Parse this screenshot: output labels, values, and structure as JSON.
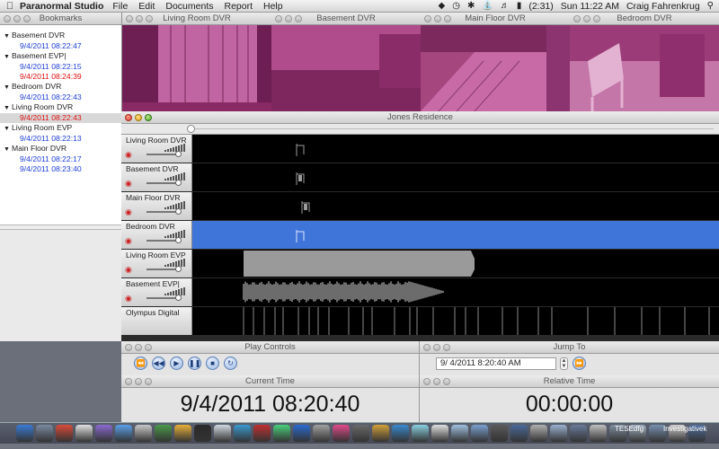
{
  "menubar": {
    "app_name": "Paranormal Studio",
    "menus": [
      "File",
      "Edit",
      "Documents",
      "Report",
      "Help"
    ],
    "battery": "(2:31)",
    "clock": "Sun 11:22 AM",
    "user": "Craig Fahrenkrug"
  },
  "bookmarks": {
    "title": "Bookmarks",
    "groups": [
      {
        "name": "Basement DVR",
        "entries": [
          {
            "time": "9/4/2011 08:22:47",
            "color": "blue"
          }
        ]
      },
      {
        "name": "Basement EVP|",
        "entries": [
          {
            "time": "9/4/2011 08:22:15",
            "color": "blue"
          },
          {
            "time": "9/4/2011 08:24:39",
            "color": "red"
          }
        ]
      },
      {
        "name": "Bedroom DVR",
        "entries": [
          {
            "time": "9/4/2011 08:22:43",
            "color": "blue"
          }
        ]
      },
      {
        "name": "Living Room DVR",
        "entries": [
          {
            "time": "9/4/2011 08:22:43",
            "color": "red",
            "selected": true
          }
        ]
      },
      {
        "name": "Living Room EVP",
        "entries": [
          {
            "time": "9/4/2011 08:22:13",
            "color": "blue"
          }
        ]
      },
      {
        "name": "Main Floor DVR",
        "entries": [
          {
            "time": "9/4/2011 08:22:17",
            "color": "blue"
          },
          {
            "time": "9/4/2011 08:23:40",
            "color": "blue"
          }
        ]
      }
    ]
  },
  "cameras": [
    {
      "title": "Living Room DVR"
    },
    {
      "title": "Basement DVR"
    },
    {
      "title": "Main Floor DVR"
    },
    {
      "title": "Bedroom DVR"
    }
  ],
  "timeline": {
    "title": "Jones Residence",
    "tracks": [
      {
        "name": "Living Room DVR"
      },
      {
        "name": "Basement DVR"
      },
      {
        "name": "Main Floor DVR"
      },
      {
        "name": "Bedroom DVR",
        "selected": true
      },
      {
        "name": "Living Room EVP"
      },
      {
        "name": "Basement EVP|"
      },
      {
        "name": "Olympus Digital"
      }
    ]
  },
  "play_controls": {
    "title": "Play Controls"
  },
  "jump_to": {
    "title": "Jump To",
    "value": "9/  4/2011    8:20:40 AM"
  },
  "current_time": {
    "title": "Current Time",
    "value": "9/4/2011 08:20:40"
  },
  "relative_time": {
    "title": "Relative Time",
    "value": "00:00:00"
  },
  "dock": {
    "labels": [
      "TESEdfg",
      "Investigativek"
    ]
  },
  "colors": {
    "selected_track": "#3f74d8",
    "camera_tint": "#b03c86",
    "bookmark_blue": "#1d3fd6",
    "bookmark_red": "#d11111"
  }
}
